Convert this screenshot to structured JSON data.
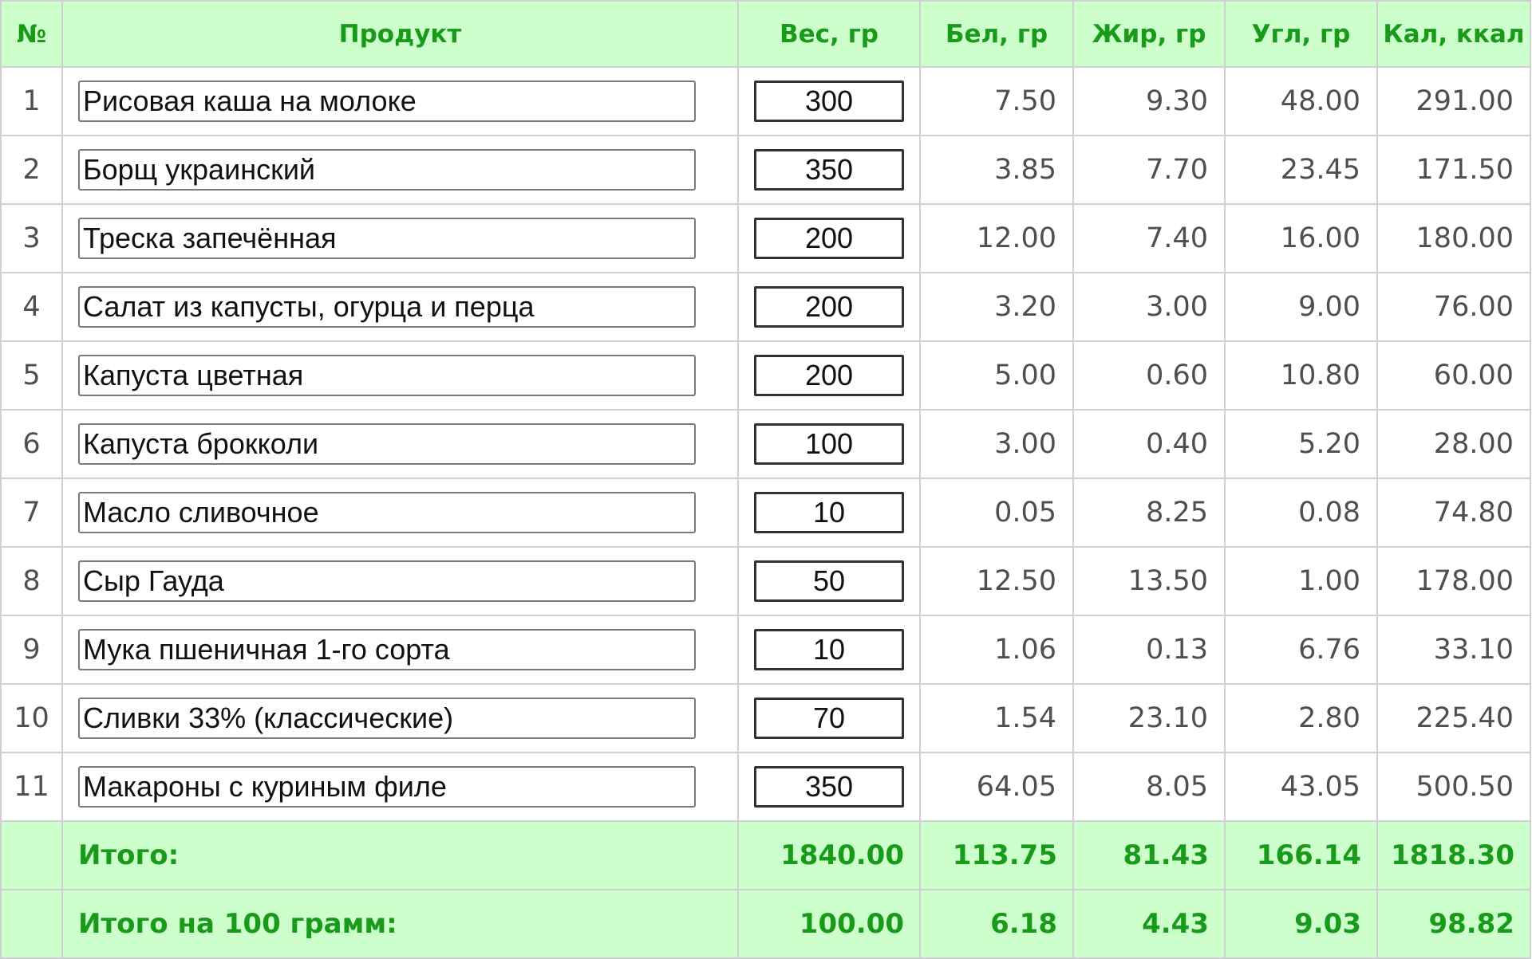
{
  "headers": {
    "num": "№",
    "product": "Продукт",
    "weight": "Вес, гр",
    "protein": "Бел, гр",
    "fat": "Жир, гр",
    "carbs": "Угл, гр",
    "kcal": "Кал, ккал"
  },
  "rows": [
    {
      "num": "1",
      "product": "Рисовая каша на молоке",
      "weight": "300",
      "protein": "7.50",
      "fat": "9.30",
      "carbs": "48.00",
      "kcal": "291.00"
    },
    {
      "num": "2",
      "product": "Борщ украинский",
      "weight": "350",
      "protein": "3.85",
      "fat": "7.70",
      "carbs": "23.45",
      "kcal": "171.50"
    },
    {
      "num": "3",
      "product": "Треска запечённая",
      "weight": "200",
      "protein": "12.00",
      "fat": "7.40",
      "carbs": "16.00",
      "kcal": "180.00"
    },
    {
      "num": "4",
      "product": "Салат из капусты, огурца и перца",
      "weight": "200",
      "protein": "3.20",
      "fat": "3.00",
      "carbs": "9.00",
      "kcal": "76.00"
    },
    {
      "num": "5",
      "product": "Капуста цветная",
      "weight": "200",
      "protein": "5.00",
      "fat": "0.60",
      "carbs": "10.80",
      "kcal": "60.00"
    },
    {
      "num": "6",
      "product": "Капуста брокколи",
      "weight": "100",
      "protein": "3.00",
      "fat": "0.40",
      "carbs": "5.20",
      "kcal": "28.00"
    },
    {
      "num": "7",
      "product": "Масло сливочное",
      "weight": "10",
      "protein": "0.05",
      "fat": "8.25",
      "carbs": "0.08",
      "kcal": "74.80"
    },
    {
      "num": "8",
      "product": "Сыр Гауда",
      "weight": "50",
      "protein": "12.50",
      "fat": "13.50",
      "carbs": "1.00",
      "kcal": "178.00"
    },
    {
      "num": "9",
      "product": "Мука пшеничная 1-го сорта",
      "weight": "10",
      "protein": "1.06",
      "fat": "0.13",
      "carbs": "6.76",
      "kcal": "33.10"
    },
    {
      "num": "10",
      "product": "Сливки 33% (классические)",
      "weight": "70",
      "protein": "1.54",
      "fat": "23.10",
      "carbs": "2.80",
      "kcal": "225.40"
    },
    {
      "num": "11",
      "product": "Макароны с куриным филе",
      "weight": "350",
      "protein": "64.05",
      "fat": "8.05",
      "carbs": "43.05",
      "kcal": "500.50"
    }
  ],
  "totals": {
    "label": "Итого:",
    "weight": "1840.00",
    "protein": "113.75",
    "fat": "81.43",
    "carbs": "166.14",
    "kcal": "1818.30"
  },
  "per100": {
    "label": "Итого на 100 грамм:",
    "weight": "100.00",
    "protein": "6.18",
    "fat": "4.43",
    "carbs": "9.03",
    "kcal": "98.82"
  },
  "colors": {
    "header_bg": "#ccffcc",
    "accent_green": "#1a9a1a",
    "grid": "#d0d0d0"
  }
}
